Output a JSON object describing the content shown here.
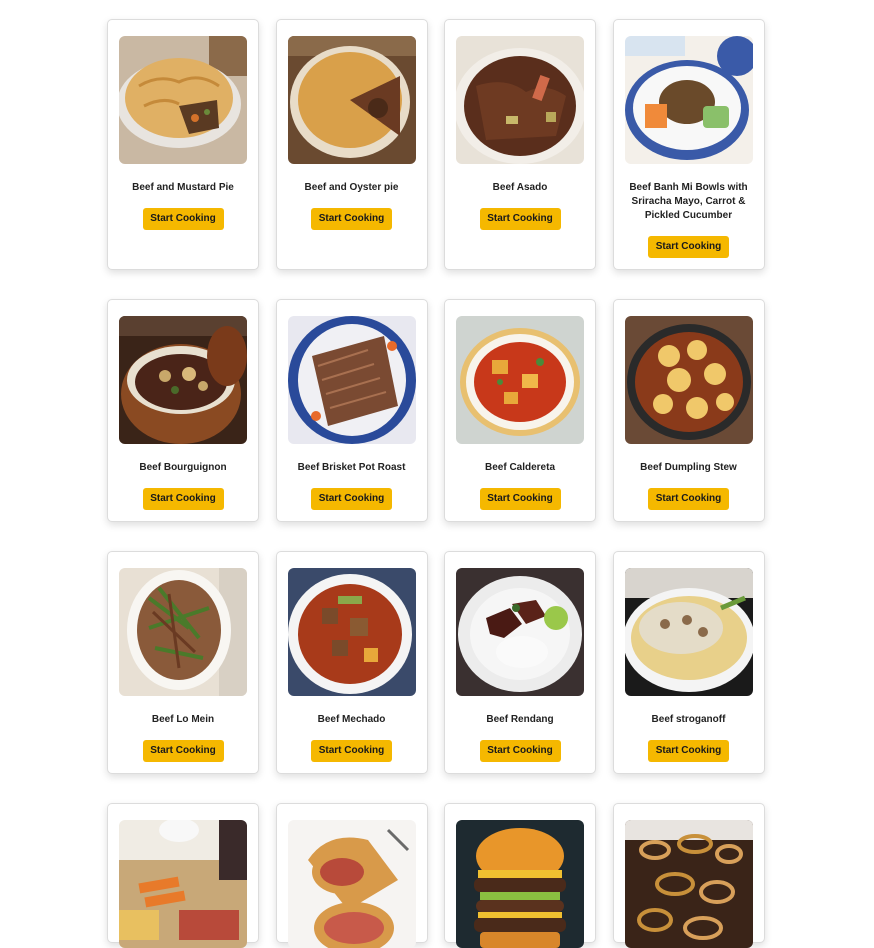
{
  "recipes": [
    {
      "name": "Beef and Mustard Pie",
      "button": "Start Cooking",
      "image": "beef-mustard-pie-image"
    },
    {
      "name": "Beef and Oyster pie",
      "button": "Start Cooking",
      "image": "beef-oyster-pie-image"
    },
    {
      "name": "Beef Asado",
      "button": "Start Cooking",
      "image": "beef-asado-image"
    },
    {
      "name": "Beef Banh Mi Bowls with Sriracha Mayo, Carrot & Pickled Cucumber",
      "button": "Start Cooking",
      "image": "beef-banh-mi-bowls-image"
    },
    {
      "name": "Beef Bourguignon",
      "button": "Start Cooking",
      "image": "beef-bourguignon-image"
    },
    {
      "name": "Beef Brisket Pot Roast",
      "button": "Start Cooking",
      "image": "beef-brisket-pot-roast-image"
    },
    {
      "name": "Beef Caldereta",
      "button": "Start Cooking",
      "image": "beef-caldereta-image"
    },
    {
      "name": "Beef Dumpling Stew",
      "button": "Start Cooking",
      "image": "beef-dumpling-stew-image"
    },
    {
      "name": "Beef Lo Mein",
      "button": "Start Cooking",
      "image": "beef-lo-mein-image"
    },
    {
      "name": "Beef Mechado",
      "button": "Start Cooking",
      "image": "beef-mechado-image"
    },
    {
      "name": "Beef Rendang",
      "button": "Start Cooking",
      "image": "beef-rendang-image"
    },
    {
      "name": "Beef stroganoff",
      "button": "Start Cooking",
      "image": "beef-stroganoff-image"
    }
  ],
  "partial_row_images": [
    "roast-beef-dinner-image",
    "beef-wellington-image",
    "burger-image",
    "beef-onions-image"
  ],
  "colors": {
    "button": "#f5b800",
    "button_text": "#1a1a1a",
    "card_border": "#dcdcdc",
    "title_text": "#222222"
  }
}
